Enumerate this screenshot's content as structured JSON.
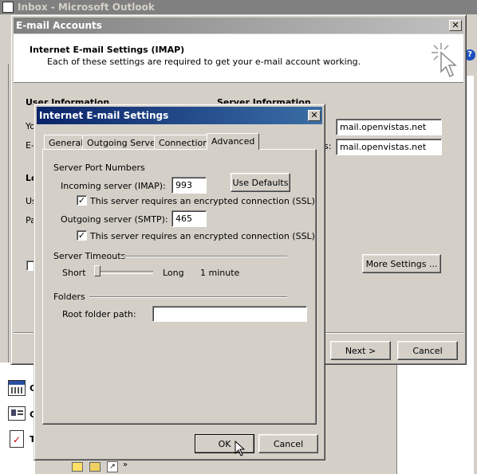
{
  "background_window": {
    "title": "Inbox - Microsoft Outlook"
  },
  "accounts_dialog": {
    "title": "E-mail Accounts",
    "header_title": "Internet E-mail Settings (IMAP)",
    "header_subtitle": "Each of these settings are required to get your e-mail account working.",
    "user_info_label": "User Information",
    "server_info_label": "Server Information",
    "your_name_label": "Yo",
    "email_label": "E-",
    "logon_label": "Lo",
    "username_label": "Us",
    "password_label": "Pa",
    "incoming_label": "s:",
    "incoming_server_value": "mail.openvistas.net",
    "outgoing_server_value": "mail.openvistas.net",
    "more_settings_label": "More Settings ...",
    "next_label": "Next >",
    "cancel_label": "Cancel"
  },
  "settings_dialog": {
    "title": "Internet E-mail Settings",
    "tabs": [
      {
        "label": "General"
      },
      {
        "label": "Outgoing Server"
      },
      {
        "label": "Connection"
      },
      {
        "label": "Advanced"
      }
    ],
    "active_tab": "Advanced",
    "server_port_numbers_label": "Server Port Numbers",
    "incoming_server_label": "Incoming server (IMAP):",
    "incoming_port": "993",
    "use_defaults_label": "Use Defaults",
    "incoming_ssl_label": "This server requires an encrypted connection (SSL)",
    "incoming_ssl_checked": true,
    "outgoing_server_label": "Outgoing server (SMTP):",
    "outgoing_port": "465",
    "outgoing_ssl_label": "This server requires an encrypted connection (SSL)",
    "outgoing_ssl_checked": true,
    "server_timeouts_label": "Server Timeouts",
    "timeout_short_label": "Short",
    "timeout_long_label": "Long",
    "timeout_value": "1 minute",
    "timeout_slider_fraction": 0.0,
    "folders_label": "Folders",
    "root_folder_label": "Root folder path:",
    "root_folder_value": "",
    "ok_label": "OK",
    "cancel_label": "Cancel"
  },
  "sidebar_icons": [
    {
      "name": "calendar-icon",
      "label": "C"
    },
    {
      "name": "contacts-icon",
      "label": "C"
    },
    {
      "name": "tasks-icon",
      "label": "T"
    }
  ],
  "colors": {
    "titlebar_active": "#0a246a",
    "titlebar_active_end": "#a6caf0",
    "titlebar_inactive": "#808080",
    "dialog_face": "#d4d0c8"
  }
}
